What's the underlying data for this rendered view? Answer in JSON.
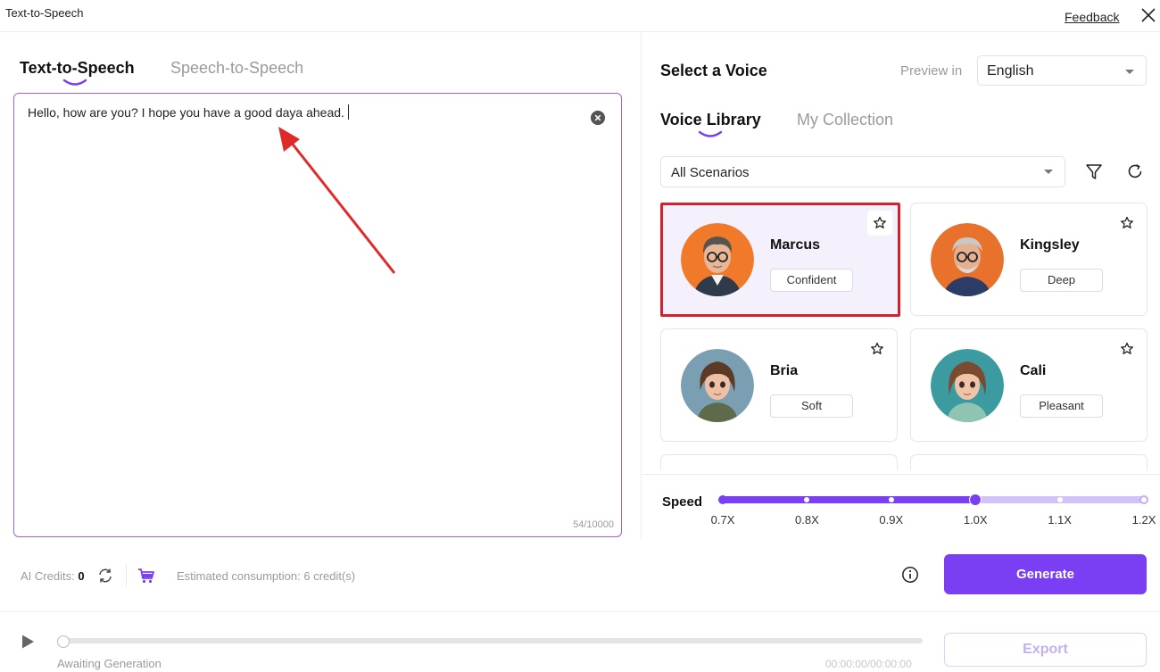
{
  "window": {
    "title": "Text-to-Speech",
    "feedback_label": "Feedback"
  },
  "left_tabs": [
    {
      "label": "Text-to-Speech",
      "active": true
    },
    {
      "label": "Speech-to-Speech",
      "active": false
    }
  ],
  "editor": {
    "text": "Hello, how are you? I hope you have a good daya ahead.",
    "char_count": "54/10000"
  },
  "voice_panel": {
    "title": "Select a Voice",
    "preview_label": "Preview in",
    "language": "English",
    "tabs": [
      {
        "label": "Voice Library",
        "active": true
      },
      {
        "label": "My Collection",
        "active": false
      }
    ],
    "scenario": "All Scenarios",
    "voices": [
      {
        "name": "Marcus",
        "tag": "Confident",
        "selected": true,
        "avatar_color": "#f07a2a"
      },
      {
        "name": "Kingsley",
        "tag": "Deep",
        "selected": false,
        "avatar_color": "#e8712c"
      },
      {
        "name": "Bria",
        "tag": "Soft",
        "selected": false,
        "avatar_color": "#7a9fb3"
      },
      {
        "name": "Cali",
        "tag": "Pleasant",
        "selected": false,
        "avatar_color": "#3c9ba0"
      }
    ]
  },
  "speed": {
    "label": "Speed",
    "ticks": [
      "0.7X",
      "0.8X",
      "0.9X",
      "1.0X",
      "1.1X",
      "1.2X"
    ],
    "selected_index": 3
  },
  "footer": {
    "credits_label": "AI Credits:",
    "credits_value": "0",
    "estimate": "Estimated consumption: 6 credit(s)",
    "generate_label": "Generate"
  },
  "player": {
    "status": "Awaiting Generation",
    "timecode": "00:00:00/00:00:00",
    "export_label": "Export"
  },
  "colors": {
    "accent": "#7a3ff2",
    "selection_border": "#d6202e",
    "annotation_arrow": "#e02a2a"
  }
}
